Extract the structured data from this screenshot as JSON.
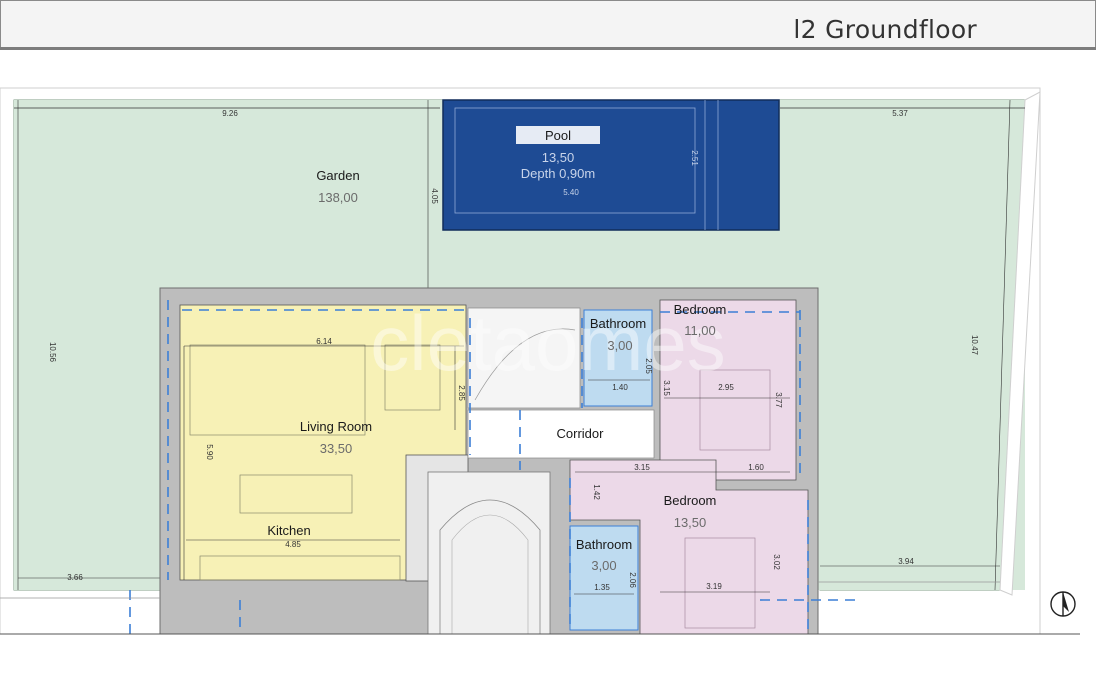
{
  "header": {
    "title": "l2 Groundfloor"
  },
  "rooms": {
    "garden": {
      "name": "Garden",
      "area": "138,00"
    },
    "pool": {
      "name": "Pool",
      "area": "13,50",
      "depth": "Depth 0,90m"
    },
    "living": {
      "name": "Living Room",
      "area": "33,50"
    },
    "kitchen": {
      "name": "Kitchen"
    },
    "corridor": {
      "name": "Corridor"
    },
    "bath1": {
      "name": "Bathroom",
      "area": "3,00"
    },
    "bath2": {
      "name": "Bathroom",
      "area": "3,00"
    },
    "bed1": {
      "name": "Bedroom",
      "area": "11,00"
    },
    "bed2": {
      "name": "Bedroom",
      "area": "13,50"
    }
  },
  "dimensions": {
    "garden_top_left": "9.26",
    "garden_top_right": "5.37",
    "garden_left_height": "10.56",
    "garden_right_height": "10.47",
    "pool_offset": "4.05",
    "pool_width": "5.40",
    "pool_height": "2.51",
    "living_width": "6.14",
    "living_height": "5.90",
    "living_inner": "2.85",
    "kitchen_width": "4.85",
    "bath1_width": "1.40",
    "bath1_height": "2.05",
    "bed1_width": "2.95",
    "bed1_left": "3.15",
    "bed1_right": "3.77",
    "bed2_top": "3.15",
    "bed2_right_top": "1.60",
    "bed2_left": "1.42",
    "bed2_width": "3.19",
    "bed2_height": "3.02",
    "bath2_width": "1.35",
    "bath2_height": "2.06",
    "garden_bottom_left": "3.66",
    "garden_bottom_right": "3.94"
  },
  "colors": {
    "garden": "#d9e9dd",
    "pool": "#1e4d96",
    "living": "#f7f1b6",
    "bedroom": "#ecd9e8",
    "bathroom": "#bedbf0",
    "wall": "#bdbdbd",
    "dash": "#3c7fd6"
  },
  "icons": {
    "compass": "compass-icon",
    "watermark": "watermark-logo"
  }
}
